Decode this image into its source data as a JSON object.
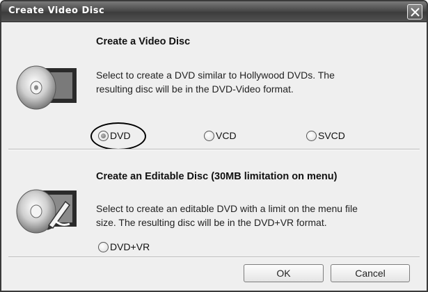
{
  "window": {
    "title": "Create Video Disc"
  },
  "video_disc": {
    "title": "Create a Video Disc",
    "description_line1": "Select to create a DVD similar to Hollywood DVDs. The",
    "description_line2": "resulting disc will be in the DVD-Video format.",
    "icon": "disc-filmstrip-icon",
    "options": [
      {
        "label": "DVD",
        "selected": true
      },
      {
        "label": "VCD",
        "selected": false
      },
      {
        "label": "SVCD",
        "selected": false
      }
    ]
  },
  "editable_disc": {
    "title": "Create an Editable Disc (30MB limitation on menu)",
    "description_line1": "Select to create an editable DVD with a limit on the menu file",
    "description_line2": "size. The resulting disc will be in the DVD+VR format.",
    "icon": "disc-edit-icon",
    "options": [
      {
        "label": "DVD+VR",
        "selected": false
      }
    ]
  },
  "buttons": {
    "ok": "OK",
    "cancel": "Cancel"
  },
  "colors": {
    "titlebar": "#4a4a4a",
    "dialog_bg": "#efefef"
  }
}
